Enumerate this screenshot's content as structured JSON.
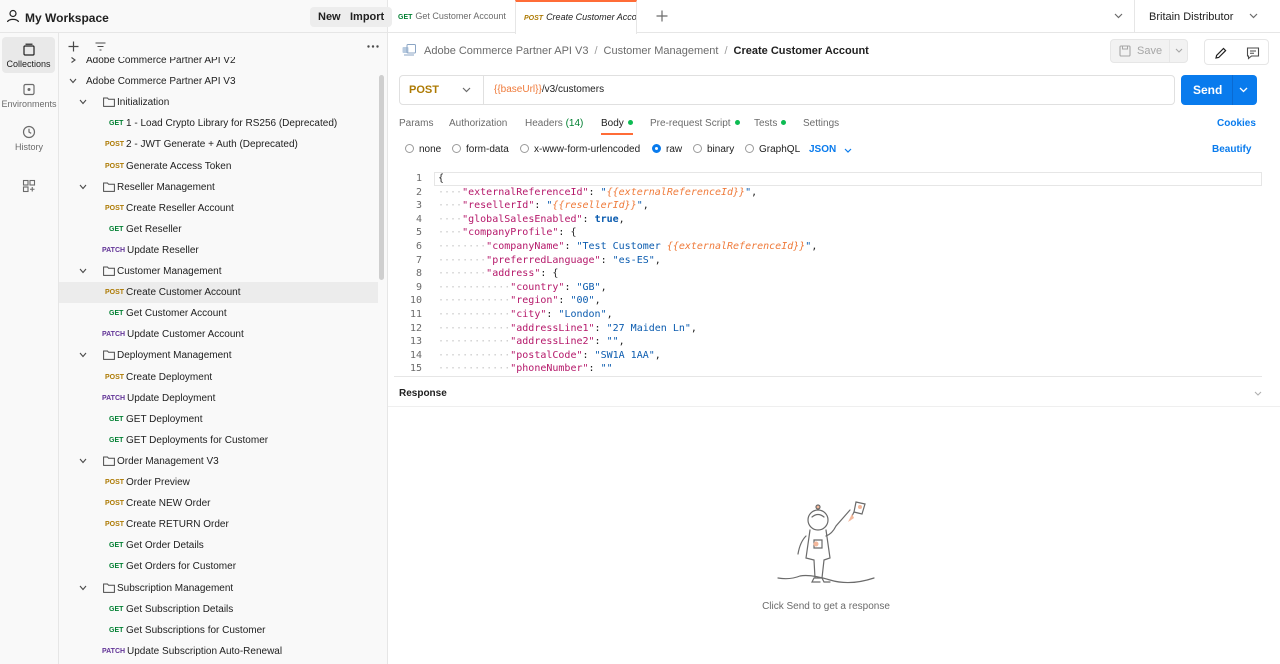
{
  "workspace": {
    "name": "My Workspace",
    "new_label": "New",
    "import_label": "Import"
  },
  "nav": {
    "collections": "Collections",
    "environments": "Environments",
    "history": "History"
  },
  "tree": {
    "rows": [
      {
        "kind": "folder",
        "level": 0,
        "label": "Adobe Commerce Partner API V2",
        "open": false
      },
      {
        "kind": "folder",
        "level": 0,
        "label": "Adobe Commerce Partner API V3",
        "open": true
      },
      {
        "kind": "folder",
        "level": 1,
        "label": "Initialization",
        "open": true
      },
      {
        "kind": "req",
        "level": 2,
        "method": "GET",
        "label": "1 - Load Crypto Library for RS256 (Deprecated)"
      },
      {
        "kind": "req",
        "level": 2,
        "method": "POST",
        "label": "2 - JWT Generate + Auth (Deprecated)"
      },
      {
        "kind": "req",
        "level": 2,
        "method": "POST",
        "label": "Generate Access Token"
      },
      {
        "kind": "folder",
        "level": 1,
        "label": "Reseller Management",
        "open": true
      },
      {
        "kind": "req",
        "level": 2,
        "method": "POST",
        "label": "Create Reseller Account"
      },
      {
        "kind": "req",
        "level": 2,
        "method": "GET",
        "label": "Get Reseller"
      },
      {
        "kind": "req",
        "level": 2,
        "method": "PATCH",
        "label": "Update Reseller"
      },
      {
        "kind": "folder",
        "level": 1,
        "label": "Customer Management",
        "open": true
      },
      {
        "kind": "req",
        "level": 2,
        "method": "POST",
        "label": "Create Customer Account",
        "selected": true
      },
      {
        "kind": "req",
        "level": 2,
        "method": "GET",
        "label": "Get Customer Account"
      },
      {
        "kind": "req",
        "level": 2,
        "method": "PATCH",
        "label": "Update Customer Account"
      },
      {
        "kind": "folder",
        "level": 1,
        "label": "Deployment Management",
        "open": true
      },
      {
        "kind": "req",
        "level": 2,
        "method": "POST",
        "label": "Create Deployment"
      },
      {
        "kind": "req",
        "level": 2,
        "method": "PATCH",
        "label": "Update Deployment"
      },
      {
        "kind": "req",
        "level": 2,
        "method": "GET",
        "label": "GET Deployment"
      },
      {
        "kind": "req",
        "level": 2,
        "method": "GET",
        "label": "GET Deployments for Customer"
      },
      {
        "kind": "folder",
        "level": 1,
        "label": "Order Management V3",
        "open": true
      },
      {
        "kind": "req",
        "level": 2,
        "method": "POST",
        "label": "Order Preview"
      },
      {
        "kind": "req",
        "level": 2,
        "method": "POST",
        "label": "Create NEW Order"
      },
      {
        "kind": "req",
        "level": 2,
        "method": "POST",
        "label": "Create RETURN Order"
      },
      {
        "kind": "req",
        "level": 2,
        "method": "GET",
        "label": "Get Order Details"
      },
      {
        "kind": "req",
        "level": 2,
        "method": "GET",
        "label": "Get Orders for Customer"
      },
      {
        "kind": "folder",
        "level": 1,
        "label": "Subscription Management",
        "open": true
      },
      {
        "kind": "req",
        "level": 2,
        "method": "GET",
        "label": "Get Subscription Details"
      },
      {
        "kind": "req",
        "level": 2,
        "method": "GET",
        "label": "Get Subscriptions for Customer"
      },
      {
        "kind": "req",
        "level": 2,
        "method": "PATCH",
        "label": "Update Subscription Auto-Renewal"
      }
    ]
  },
  "tabs": [
    {
      "method": "GET",
      "label": "Get Customer Account"
    },
    {
      "method": "POST",
      "label": "Create Customer Acco",
      "active": true
    }
  ],
  "environment": "Britain Distributor",
  "breadcrumb": {
    "items": [
      "Adobe Commerce Partner API V3",
      "Customer Management"
    ],
    "current": "Create Customer Account"
  },
  "save_label": "Save",
  "request": {
    "method": "POST",
    "url_var": "{{baseUrl}}",
    "url_path": "/v3/customers",
    "send_label": "Send"
  },
  "req_tabs": {
    "params": "Params",
    "authorization": "Authorization",
    "headers": "Headers",
    "headers_count": "(14)",
    "body": "Body",
    "prerequest": "Pre-request Script",
    "tests": "Tests",
    "settings": "Settings",
    "cookies": "Cookies"
  },
  "body_options": {
    "none": "none",
    "form_data": "form-data",
    "urlencoded": "x-www-form-urlencoded",
    "raw": "raw",
    "binary": "binary",
    "graphql": "GraphQL",
    "format": "JSON",
    "beautify": "Beautify",
    "selected": "raw"
  },
  "code_lines": [
    {
      "n": 1,
      "indent": 0,
      "parts": [
        [
          "p",
          "{"
        ]
      ]
    },
    {
      "n": 2,
      "indent": 1,
      "parts": [
        [
          "k",
          "\"externalReferenceId\""
        ],
        [
          "p",
          ": "
        ],
        [
          "s",
          "\""
        ],
        [
          "v",
          "{{externalReferenceId}}"
        ],
        [
          "s",
          "\""
        ],
        [
          "p",
          ","
        ]
      ]
    },
    {
      "n": 3,
      "indent": 1,
      "parts": [
        [
          "k",
          "\"resellerId\""
        ],
        [
          "p",
          ": "
        ],
        [
          "s",
          "\""
        ],
        [
          "v",
          "{{resellerId}}"
        ],
        [
          "s",
          "\""
        ],
        [
          "p",
          ","
        ]
      ]
    },
    {
      "n": 4,
      "indent": 1,
      "parts": [
        [
          "k",
          "\"globalSalesEnabled\""
        ],
        [
          "p",
          ": "
        ],
        [
          "b",
          "true"
        ],
        [
          "p",
          ","
        ]
      ]
    },
    {
      "n": 5,
      "indent": 1,
      "parts": [
        [
          "k",
          "\"companyProfile\""
        ],
        [
          "p",
          ": {"
        ]
      ]
    },
    {
      "n": 6,
      "indent": 2,
      "parts": [
        [
          "k",
          "\"companyName\""
        ],
        [
          "p",
          ": "
        ],
        [
          "s",
          "\"Test Customer "
        ],
        [
          "v",
          "{{externalReferenceId}}"
        ],
        [
          "s",
          "\""
        ],
        [
          "p",
          ","
        ]
      ]
    },
    {
      "n": 7,
      "indent": 2,
      "parts": [
        [
          "k",
          "\"preferredLanguage\""
        ],
        [
          "p",
          ": "
        ],
        [
          "s",
          "\"es-ES\""
        ],
        [
          "p",
          ","
        ]
      ]
    },
    {
      "n": 8,
      "indent": 2,
      "parts": [
        [
          "k",
          "\"address\""
        ],
        [
          "p",
          ": {"
        ]
      ]
    },
    {
      "n": 9,
      "indent": 3,
      "parts": [
        [
          "k",
          "\"country\""
        ],
        [
          "p",
          ": "
        ],
        [
          "s",
          "\"GB\""
        ],
        [
          "p",
          ","
        ]
      ]
    },
    {
      "n": 10,
      "indent": 3,
      "parts": [
        [
          "k",
          "\"region\""
        ],
        [
          "p",
          ": "
        ],
        [
          "s",
          "\"00\""
        ],
        [
          "p",
          ","
        ]
      ]
    },
    {
      "n": 11,
      "indent": 3,
      "parts": [
        [
          "k",
          "\"city\""
        ],
        [
          "p",
          ": "
        ],
        [
          "s",
          "\"London\""
        ],
        [
          "p",
          ","
        ]
      ]
    },
    {
      "n": 12,
      "indent": 3,
      "parts": [
        [
          "k",
          "\"addressLine1\""
        ],
        [
          "p",
          ": "
        ],
        [
          "s",
          "\"27 Maiden Ln\""
        ],
        [
          "p",
          ","
        ]
      ]
    },
    {
      "n": 13,
      "indent": 3,
      "parts": [
        [
          "k",
          "\"addressLine2\""
        ],
        [
          "p",
          ": "
        ],
        [
          "s",
          "\"\""
        ],
        [
          "p",
          ","
        ]
      ]
    },
    {
      "n": 14,
      "indent": 3,
      "parts": [
        [
          "k",
          "\"postalCode\""
        ],
        [
          "p",
          ": "
        ],
        [
          "s",
          "\"SW1A 1AA\""
        ],
        [
          "p",
          ","
        ]
      ]
    },
    {
      "n": 15,
      "indent": 3,
      "parts": [
        [
          "k",
          "\"phoneNumber\""
        ],
        [
          "p",
          ": "
        ],
        [
          "s",
          "\"\""
        ]
      ]
    }
  ],
  "response": {
    "title": "Response",
    "empty_text": "Click Send to get a response"
  },
  "colors": {
    "accent": "#ff6c37",
    "send": "#097bed",
    "get": "#007f31",
    "post": "#ad7a03",
    "patch": "#623497"
  }
}
